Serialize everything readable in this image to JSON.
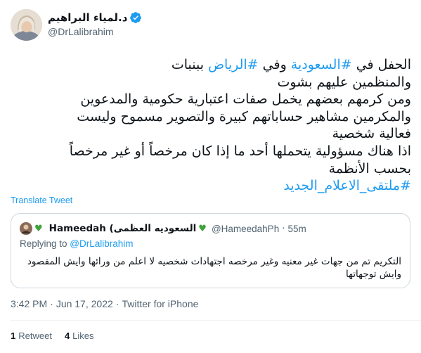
{
  "author": {
    "display_name": "د.لمياء البراهيم",
    "handle": "@DrLalibrahim",
    "verified": true
  },
  "tweet": {
    "lines": [
      [
        {
          "t": "الحفل في ",
          "hl": false
        },
        {
          "t": "#السعودية",
          "hl": true
        },
        {
          "t": " وفي ",
          "hl": false
        },
        {
          "t": "#الرياض",
          "hl": true
        },
        {
          "t": " ببنبات",
          "hl": false
        }
      ],
      [
        {
          "t": "والمنظمين عليهم بشوت",
          "hl": false
        }
      ],
      [
        {
          "t": "ومن كرمهم بعضهم يخمل صفات اعتبارية حكومية  والمدعوين",
          "hl": false
        }
      ],
      [
        {
          "t": "والمكرمين مشاهير حساباتهم كبيرة والتصوير مسموح وليست",
          "hl": false
        }
      ],
      [
        {
          "t": "فعالية شخصية",
          "hl": false
        }
      ],
      [
        {
          "t": "اذا هناك مسؤولية يتحملها أحد ما إذا كان مرخصاً أو غير مرخصاً",
          "hl": false
        }
      ],
      [
        {
          "t": "بحسب الأنظمة",
          "hl": false
        }
      ],
      [
        {
          "t": "#ملتقى_الاعلام_الجديد",
          "hl": true
        }
      ]
    ]
  },
  "translate_label": "Translate Tweet",
  "quote": {
    "name": "Hameedah⁩ (السعوديه العظمى",
    "handle": "@HameedahPh",
    "time": "55m",
    "replying_prefix": "Replying to ",
    "replying_mention": "@DrLalibrahim",
    "text_lines": [
      "التكريم تم من جهات غير معنيه وغير مرخصه اجتهادات شخصيه لا اعلم من ورائها وايش المقصود",
      "وايش توجهاتها"
    ]
  },
  "meta": {
    "time": "3:42 PM",
    "date": "Jun 17, 2022",
    "source": "Twitter for iPhone"
  },
  "stats": {
    "retweets_count": "1",
    "retweets_label": "Retweet",
    "likes_count": "4",
    "likes_label": "Likes"
  },
  "colors": {
    "accent": "#1d9bf0",
    "secondary_text": "#536471",
    "heart_green": "#3fa23a"
  }
}
